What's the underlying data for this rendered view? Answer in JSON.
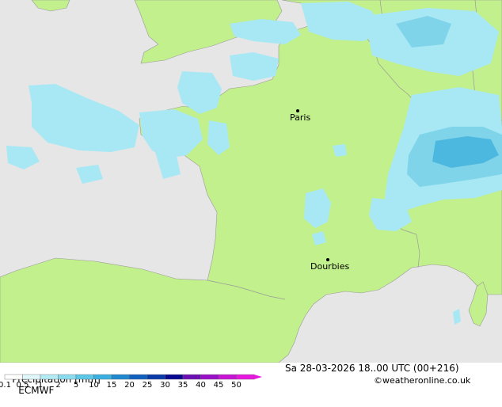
{
  "colors": {
    "sea": "#e6e6e6",
    "land": "#c2f08c",
    "precip_light": "#a8e8f4",
    "precip_mid": "#7fd4ea",
    "precip_heavy": "#4cb8e0",
    "border": "#9a9a9a"
  },
  "cities": [
    {
      "name": "Paris"
    },
    {
      "name": "Dourbies"
    }
  ],
  "footer": {
    "title": "Precipitation [mm]",
    "model": "ECMWF",
    "datetime": "Sa 28-03-2026 18..00 UTC (00+216)",
    "credit": "©weatheronline.co.uk",
    "legend": {
      "labels": [
        "0.1",
        "0.5",
        "1",
        "2",
        "5",
        "10",
        "15",
        "20",
        "25",
        "30",
        "35",
        "40",
        "45",
        "50"
      ],
      "colors": [
        "#ffffff",
        "#e0f8fc",
        "#b4ecf6",
        "#8cdcf0",
        "#5cc8e8",
        "#3ab0e0",
        "#1e88d0",
        "#1060c0",
        "#0a3aa8",
        "#080890",
        "#6c10b4",
        "#9a10c8",
        "#c814d4",
        "#e818e0"
      ]
    }
  }
}
